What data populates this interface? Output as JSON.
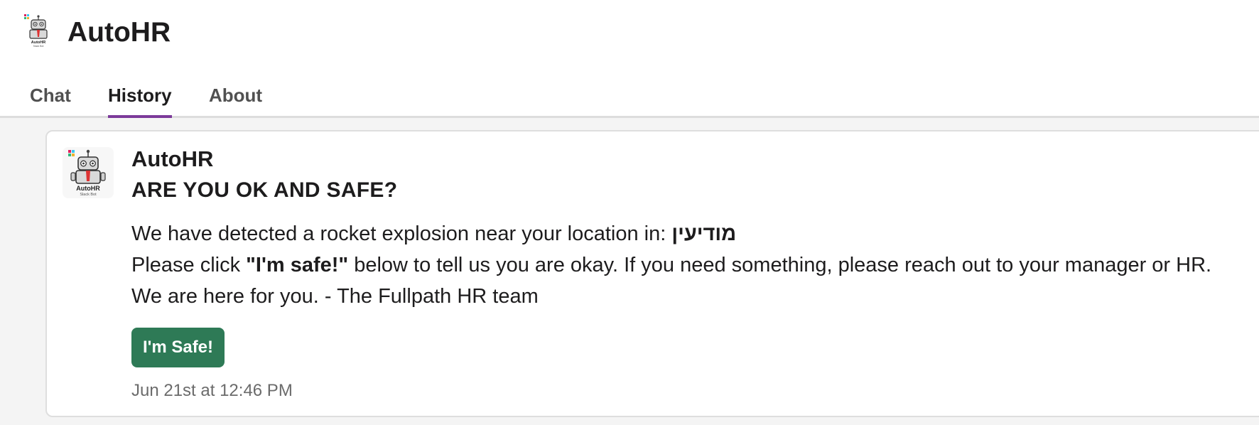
{
  "app": {
    "title": "AutoHR",
    "icon": "robot-icon",
    "icon_caption": "AutoHR",
    "icon_subcaption": "Slack Bot"
  },
  "tabs": [
    {
      "label": "Chat",
      "active": false
    },
    {
      "label": "History",
      "active": true
    },
    {
      "label": "About",
      "active": false
    }
  ],
  "message": {
    "sender": "AutoHR",
    "title": "ARE YOU OK AND SAFE?",
    "line1_prefix": "We have detected a rocket explosion near your location in: ",
    "line1_location": "מודיעין",
    "line2_prefix": "Please click ",
    "line2_bold": "\"I'm safe!\"",
    "line2_suffix": " below to tell us you are okay. If you need something, please reach out to your manager or HR.",
    "line3": "We are here for you. - The Fullpath HR team",
    "button_label": "I'm Safe!",
    "timestamp": "Jun 21st at 12:46 PM"
  },
  "colors": {
    "accent": "#7c3a9a",
    "button": "#2e7a56",
    "background": "#f4f4f4"
  }
}
